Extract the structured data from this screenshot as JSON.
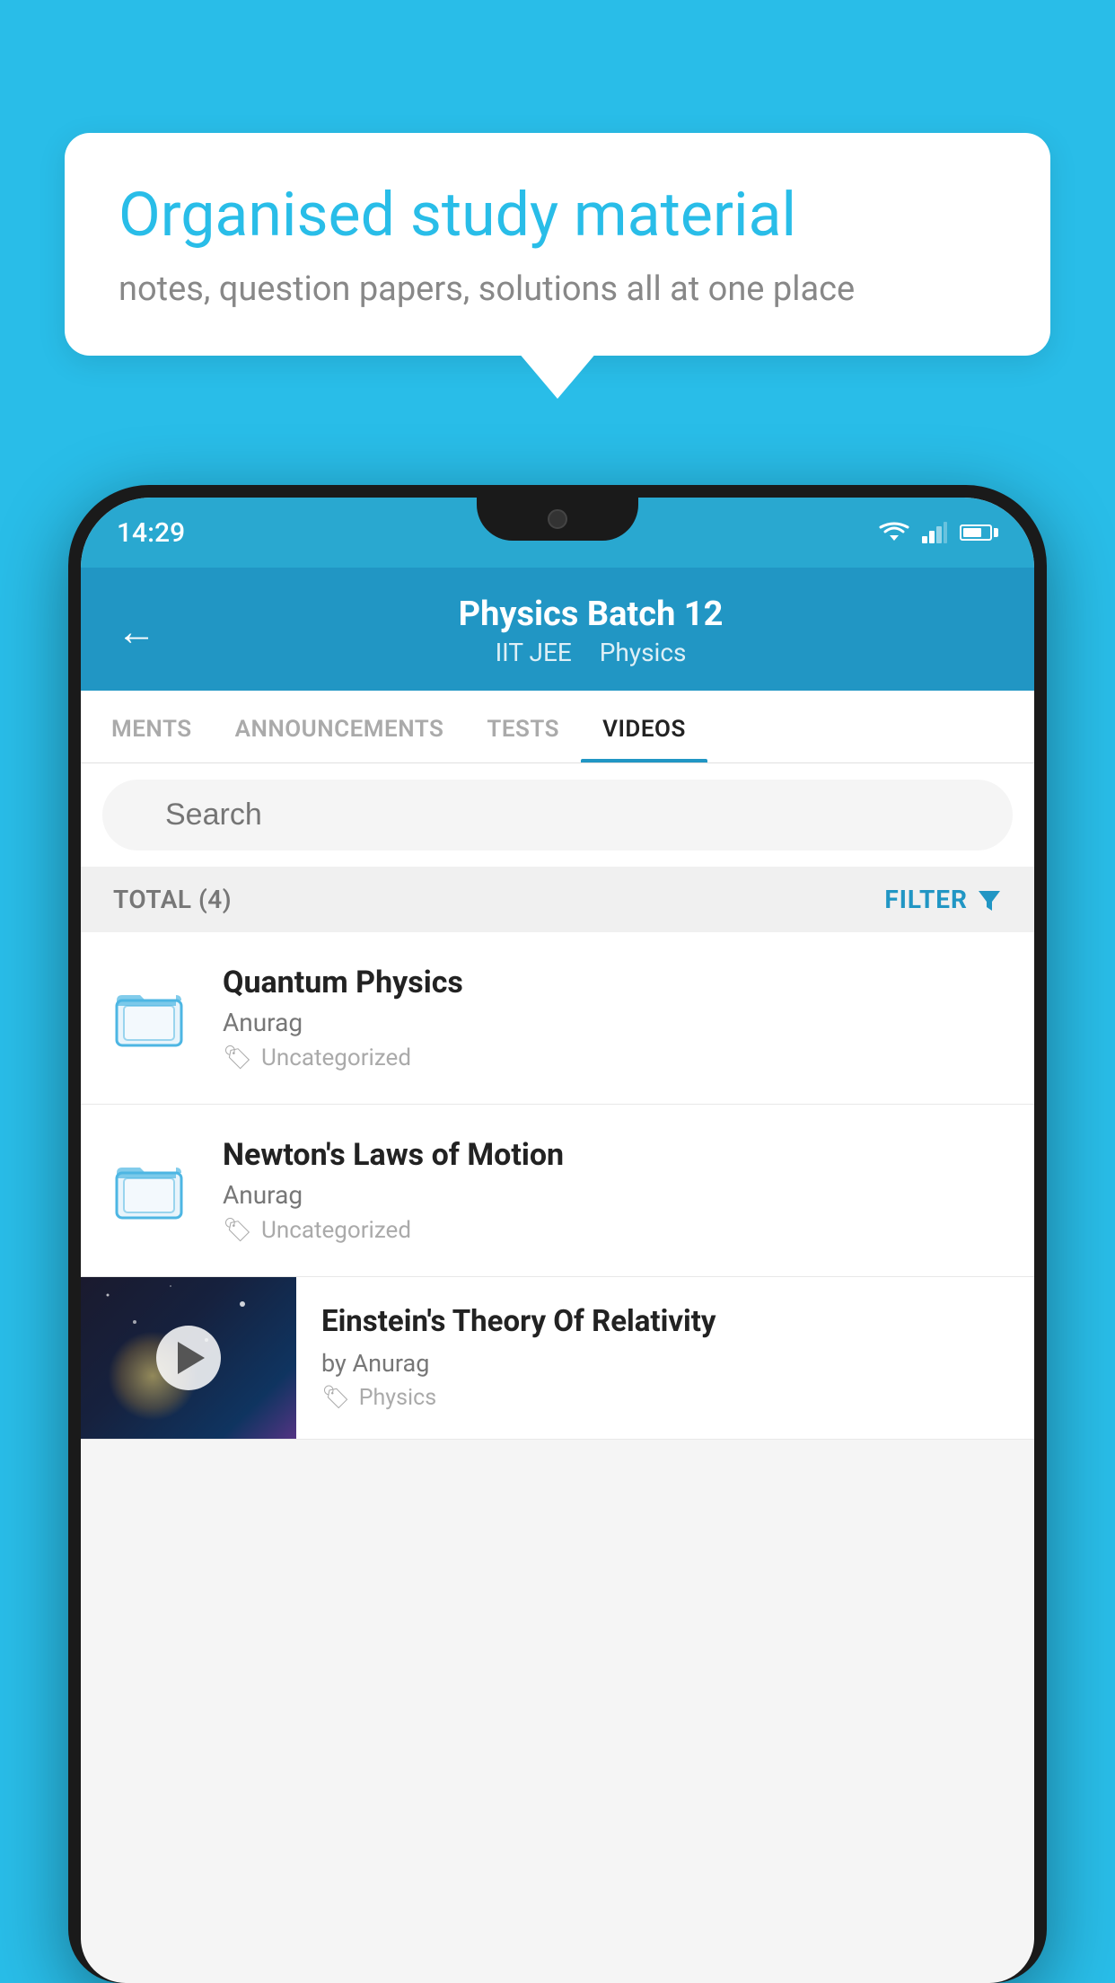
{
  "background_color": "#29bde8",
  "speech_bubble": {
    "title": "Organised study material",
    "subtitle": "notes, question papers, solutions all at one place"
  },
  "phone": {
    "status_bar": {
      "time": "14:29"
    },
    "header": {
      "title": "Physics Batch 12",
      "tag1": "IIT JEE",
      "tag2": "Physics",
      "back_label": "←"
    },
    "tabs": [
      {
        "label": "MENTS",
        "active": false
      },
      {
        "label": "ANNOUNCEMENTS",
        "active": false
      },
      {
        "label": "TESTS",
        "active": false
      },
      {
        "label": "VIDEOS",
        "active": true
      }
    ],
    "search": {
      "placeholder": "Search"
    },
    "filter_bar": {
      "total_label": "TOTAL (4)",
      "filter_label": "FILTER"
    },
    "video_list": [
      {
        "title": "Quantum Physics",
        "author": "Anurag",
        "tag": "Uncategorized",
        "has_thumb": false
      },
      {
        "title": "Newton's Laws of Motion",
        "author": "Anurag",
        "tag": "Uncategorized",
        "has_thumb": false
      },
      {
        "title": "Einstein's Theory Of Relativity",
        "author": "by Anurag",
        "tag": "Physics",
        "has_thumb": true
      }
    ]
  }
}
